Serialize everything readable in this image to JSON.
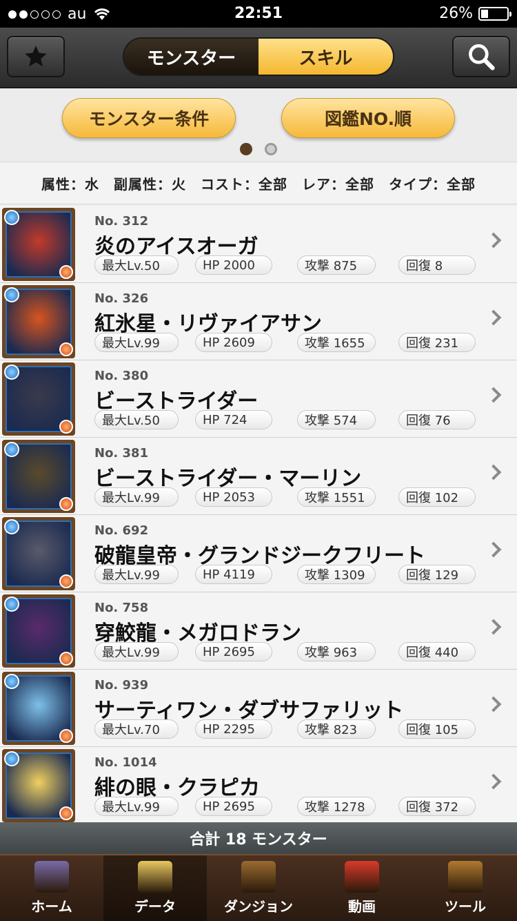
{
  "status": {
    "carrier": "au",
    "time": "22:51",
    "battery": "26%"
  },
  "nav": {
    "seg_left": "モンスター",
    "seg_right": "スキル"
  },
  "filters": {
    "btn_left": "モンスター条件",
    "btn_right": "図鑑NO.順",
    "summary": "属性：水　副属性：火　コスト：全部　レア：全部　タイプ：全部"
  },
  "monsters": [
    {
      "no": "No. 312",
      "name": "炎のアイスオーガ",
      "lv": "最大Lv.50",
      "hp": "HP 2000",
      "atk": "攻撃 875",
      "rcv": "回復 8"
    },
    {
      "no": "No. 326",
      "name": "紅氷星・リヴァイアサン",
      "lv": "最大Lv.99",
      "hp": "HP 2609",
      "atk": "攻撃 1655",
      "rcv": "回復 231"
    },
    {
      "no": "No. 380",
      "name": "ビーストライダー",
      "lv": "最大Lv.50",
      "hp": "HP 724",
      "atk": "攻撃 574",
      "rcv": "回復 76"
    },
    {
      "no": "No. 381",
      "name": "ビーストライダー・マーリン",
      "lv": "最大Lv.99",
      "hp": "HP 2053",
      "atk": "攻撃 1551",
      "rcv": "回復 102"
    },
    {
      "no": "No. 692",
      "name": "破龍皇帝・グランドジークフリート",
      "lv": "最大Lv.99",
      "hp": "HP 4119",
      "atk": "攻撃 1309",
      "rcv": "回復 129"
    },
    {
      "no": "No. 758",
      "name": "穿鮫龍・メガロドラン",
      "lv": "最大Lv.99",
      "hp": "HP 2695",
      "atk": "攻撃 963",
      "rcv": "回復 440"
    },
    {
      "no": "No. 939",
      "name": "サーティワン・ダブサファリット",
      "lv": "最大Lv.70",
      "hp": "HP 2295",
      "atk": "攻撃 823",
      "rcv": "回復 105"
    },
    {
      "no": "No. 1014",
      "name": "緋の眼・クラピカ",
      "lv": "最大Lv.99",
      "hp": "HP 2695",
      "atk": "攻撃 1278",
      "rcv": "回復 372"
    }
  ],
  "total": "合計 18 モンスター",
  "tabs": [
    {
      "label": "ホーム",
      "icon": "quill-icon",
      "color": "#7a6aa8"
    },
    {
      "label": "データ",
      "icon": "book-icon",
      "color": "#e8c860"
    },
    {
      "label": "ダンジョン",
      "icon": "gate-icon",
      "color": "#9a6a30"
    },
    {
      "label": "動画",
      "icon": "play-icon",
      "color": "#d83a2a"
    },
    {
      "label": "ツール",
      "icon": "chest-icon",
      "color": "#b07a30"
    }
  ],
  "thumb_colors": [
    "#c23a2a",
    "#d8541e",
    "#3a3a4a",
    "#5a4a2a",
    "#5a5a6a",
    "#5a2a6a",
    "#7ec0e8",
    "#f0d060"
  ]
}
